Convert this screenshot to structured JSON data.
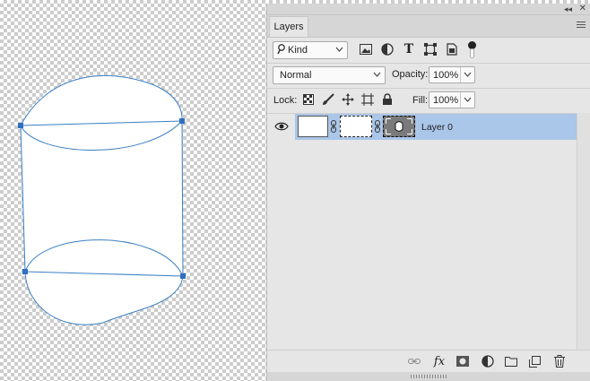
{
  "panel": {
    "tab_label": "Layers",
    "collapse_glyph": "◂◂",
    "close_glyph": "✕"
  },
  "filter": {
    "kind_label": "Kind",
    "icons": [
      "image-filter-icon",
      "adjustment-filter-icon",
      "type-filter-icon",
      "shape-filter-icon",
      "smart-object-filter-icon"
    ],
    "type_glyph": "T"
  },
  "blend": {
    "mode": "Normal",
    "opacity_label": "Opacity:",
    "opacity_value": "100%"
  },
  "lock": {
    "label": "Lock:",
    "icons": [
      "lock-transparent-pixels-icon",
      "lock-image-pixels-icon",
      "lock-position-icon",
      "lock-artboard-icon",
      "lock-all-icon"
    ],
    "fill_label": "Fill:",
    "fill_value": "100%"
  },
  "layers": [
    {
      "name": "Layer 0",
      "visible": true,
      "selected": true
    }
  ],
  "bottom_bar": {
    "fx_label": "fx",
    "icons": [
      "link-layers-icon",
      "layer-style-fx-icon",
      "add-mask-icon",
      "adjustment-layer-icon",
      "new-group-folder-icon",
      "new-layer-icon",
      "trash-icon"
    ]
  },
  "colors": {
    "path_stroke": "#3a7fc4",
    "anchor_fill": "#2f6fbf",
    "selection_highlight": "#aac6e8",
    "panel_bg": "#e6e6e6"
  }
}
